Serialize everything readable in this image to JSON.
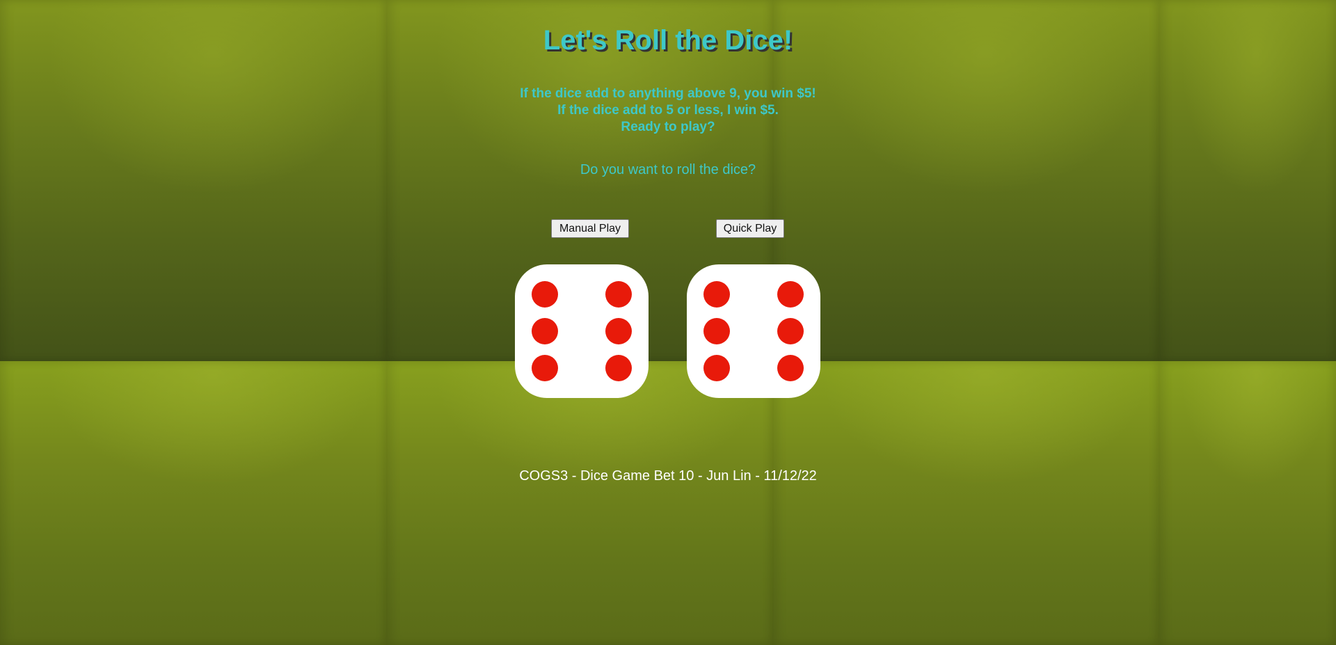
{
  "game": {
    "title": "Let's Roll the Dice!",
    "rules": [
      "If the dice add to anything above 9, you win $5!",
      "If the dice add to 5 or less, I win $5.",
      "Ready to play?"
    ],
    "question": "Do you want to roll the dice?",
    "buttons": {
      "manual": "Manual Play",
      "quick": "Quick Play"
    },
    "dice": [
      {
        "value": 6,
        "face_color": "#ffffff",
        "pip_color": "#e81a0a"
      },
      {
        "value": 6,
        "face_color": "#ffffff",
        "pip_color": "#e81a0a"
      }
    ],
    "footer": "COGS3 - Dice Game Bet 10 - Jun Lin - 11/12/22"
  },
  "colors": {
    "accent": "#3ec8c8",
    "background": "#5a6a1c",
    "footer_text": "#ffffff"
  }
}
